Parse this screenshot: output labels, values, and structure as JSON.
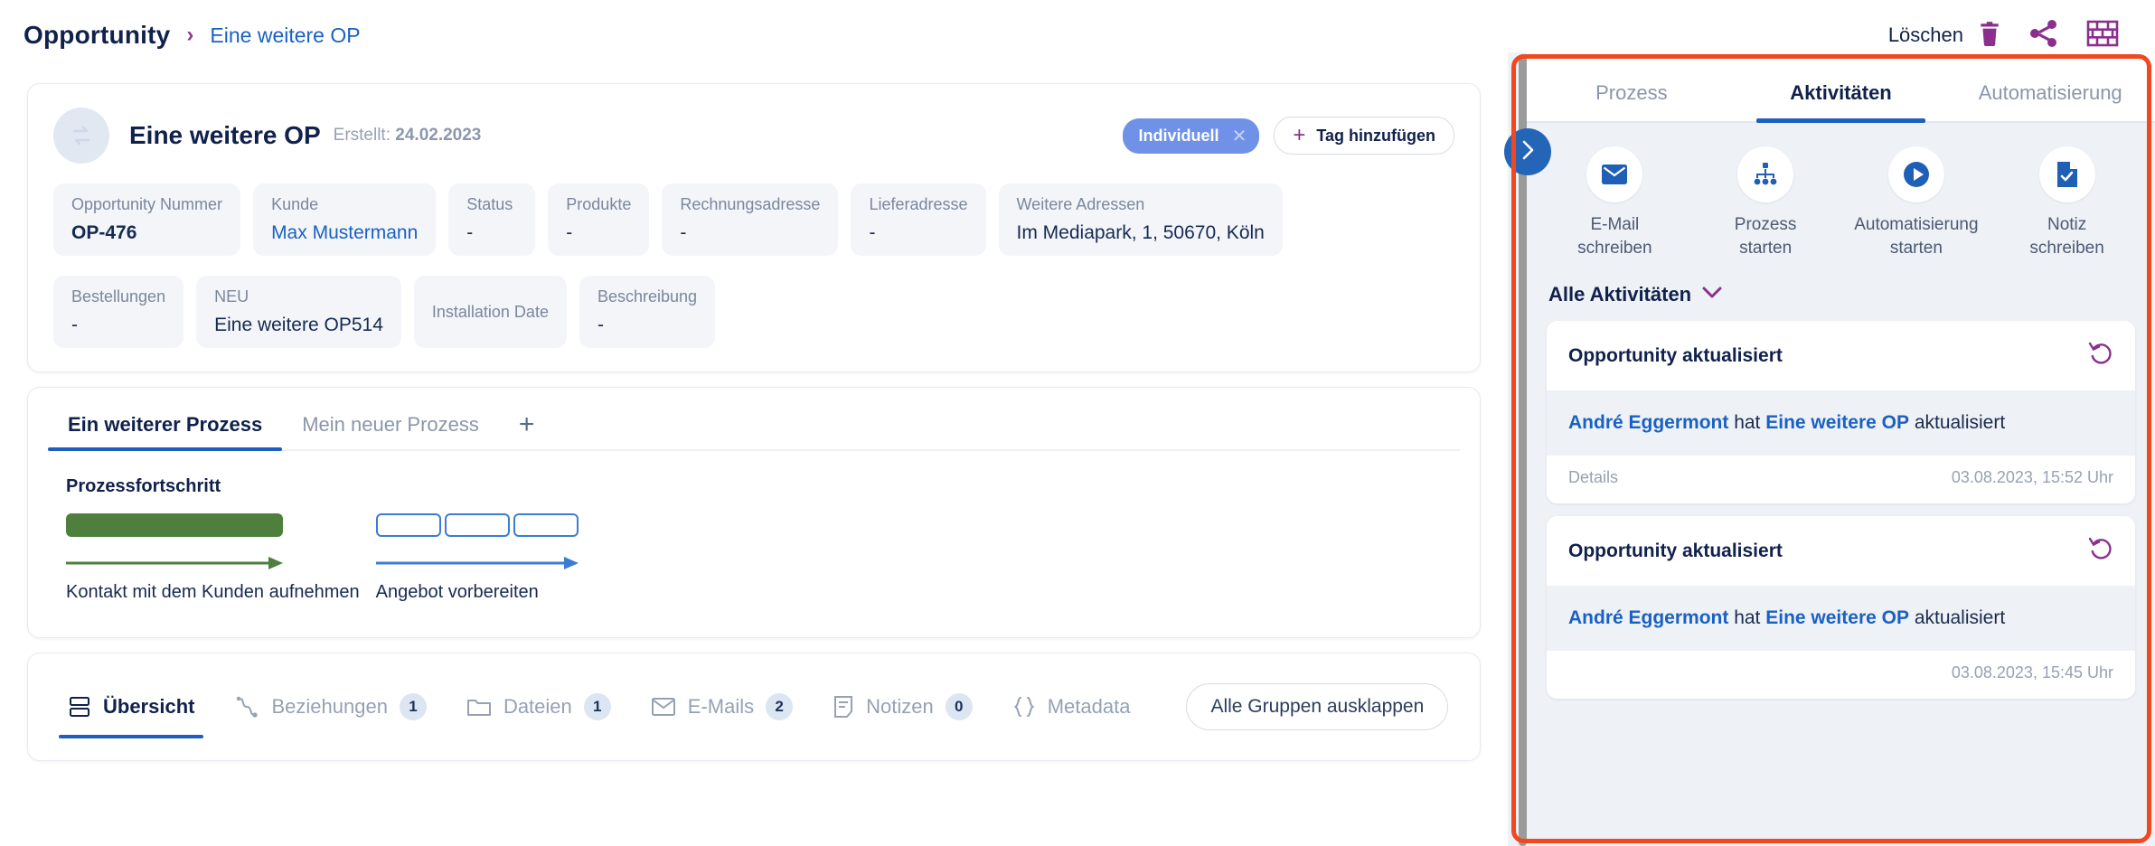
{
  "breadcrumb": {
    "root": "Opportunity",
    "separator": "›",
    "current": "Eine weitere OP"
  },
  "topbar": {
    "delete_label": "Löschen",
    "delete_icon": "trash-icon",
    "share_icon": "share-icon",
    "grid_icon": "brick-grid-icon"
  },
  "record": {
    "avatar_icon": "exchange-arrows-icon",
    "title": "Eine weitere OP",
    "created_label": "Erstellt:",
    "created_value": "24.02.2023",
    "tag": {
      "label": "Individuell",
      "remove_icon": "close-icon"
    },
    "add_tag_label": "Tag hinzufügen",
    "add_tag_icon": "plus-icon",
    "fields_row1": [
      {
        "label": "Opportunity Nummer",
        "value": "OP-476",
        "style": "bold"
      },
      {
        "label": "Kunde",
        "value": "Max Mustermann",
        "style": "link"
      },
      {
        "label": "Status",
        "value": "-",
        "style": "plain"
      },
      {
        "label": "Produkte",
        "value": "-",
        "style": "plain"
      },
      {
        "label": "Rechnungsadresse",
        "value": "-",
        "style": "plain"
      },
      {
        "label": "Lieferadresse",
        "value": "-",
        "style": "plain"
      },
      {
        "label": "Weitere Adressen",
        "value": "Im Mediapark, 1, 50670, Köln",
        "style": "plain"
      }
    ],
    "fields_row2": [
      {
        "label": "Bestellungen",
        "value": "-",
        "style": "plain"
      },
      {
        "label": "NEU",
        "value": "Eine weitere OP514",
        "style": "plain"
      },
      {
        "label": "Installation Date",
        "value": "",
        "style": "plain"
      },
      {
        "label": "Beschreibung",
        "value": "-",
        "style": "plain"
      }
    ]
  },
  "process": {
    "tabs": [
      {
        "label": "Ein weiterer Prozess",
        "active": true
      },
      {
        "label": "Mein neuer Prozess",
        "active": false
      }
    ],
    "add_tab_icon": "plus-icon",
    "add_tab_label": "+",
    "progress_title": "Prozessfortschritt",
    "steps": [
      {
        "label": "Kontakt mit dem Kunden aufnehmen",
        "state": "done",
        "segments": 1
      },
      {
        "label": "Angebot vorbereiten",
        "state": "todo",
        "segments": 3
      }
    ],
    "colors": {
      "done": "#4e7f3d",
      "todo": "#3d7cd3"
    }
  },
  "bottom_tabs": [
    {
      "label": "Übersicht",
      "icon": "overview-icon",
      "count": null,
      "active": true
    },
    {
      "label": "Beziehungen",
      "icon": "relations-icon",
      "count": "1",
      "active": false
    },
    {
      "label": "Dateien",
      "icon": "folder-icon",
      "count": "1",
      "active": false
    },
    {
      "label": "E-Mails",
      "icon": "envelope-icon",
      "count": "2",
      "active": false
    },
    {
      "label": "Notizen",
      "icon": "note-icon",
      "count": "0",
      "active": false
    },
    {
      "label": "Metadata",
      "icon": "braces-icon",
      "count": null,
      "active": false
    }
  ],
  "expand_groups_label": "Alle Gruppen ausklappen",
  "right_panel": {
    "collapse_icon": "chevron-right-icon",
    "drag_handle": "panel-resize-handle",
    "tabs": [
      {
        "label": "Prozess",
        "active": false
      },
      {
        "label": "Aktivitäten",
        "active": true
      },
      {
        "label": "Automatisierung",
        "active": false
      }
    ],
    "quick_actions": [
      {
        "icon": "envelope-icon",
        "line1": "E-Mail",
        "line2": "schreiben"
      },
      {
        "icon": "org-chart-icon",
        "line1": "Prozess",
        "line2": "starten"
      },
      {
        "icon": "play-circle-icon",
        "line1": "Automatisierung",
        "line2": "starten"
      },
      {
        "icon": "note-check-icon",
        "line1": "Notiz",
        "line2": "schreiben"
      }
    ],
    "filter_label": "Alle Aktivitäten",
    "filter_icon": "chevron-down-icon",
    "activities": [
      {
        "title": "Opportunity aktualisiert",
        "action_icon": "restore-icon",
        "actor": "André Eggermont",
        "middle_text": "hat",
        "object": "Eine weitere OP",
        "suffix": "aktualisiert",
        "details_label": "Details",
        "timestamp": "03.08.2023, 15:52 Uhr"
      },
      {
        "title": "Opportunity aktualisiert",
        "action_icon": "restore-icon",
        "actor": "André Eggermont",
        "middle_text": "hat",
        "object": "Eine weitere OP",
        "suffix": "aktualisiert",
        "details_label": "",
        "timestamp": "03.08.2023, 15:45 Uhr"
      }
    ]
  },
  "colors": {
    "accent_blue": "#1c5fbe",
    "accent_purple": "#8a2f8e",
    "link_blue": "#1961c4",
    "done_green": "#4e7f3d",
    "highlight_red": "#f1481f",
    "panel_bg": "#eef1f6"
  }
}
